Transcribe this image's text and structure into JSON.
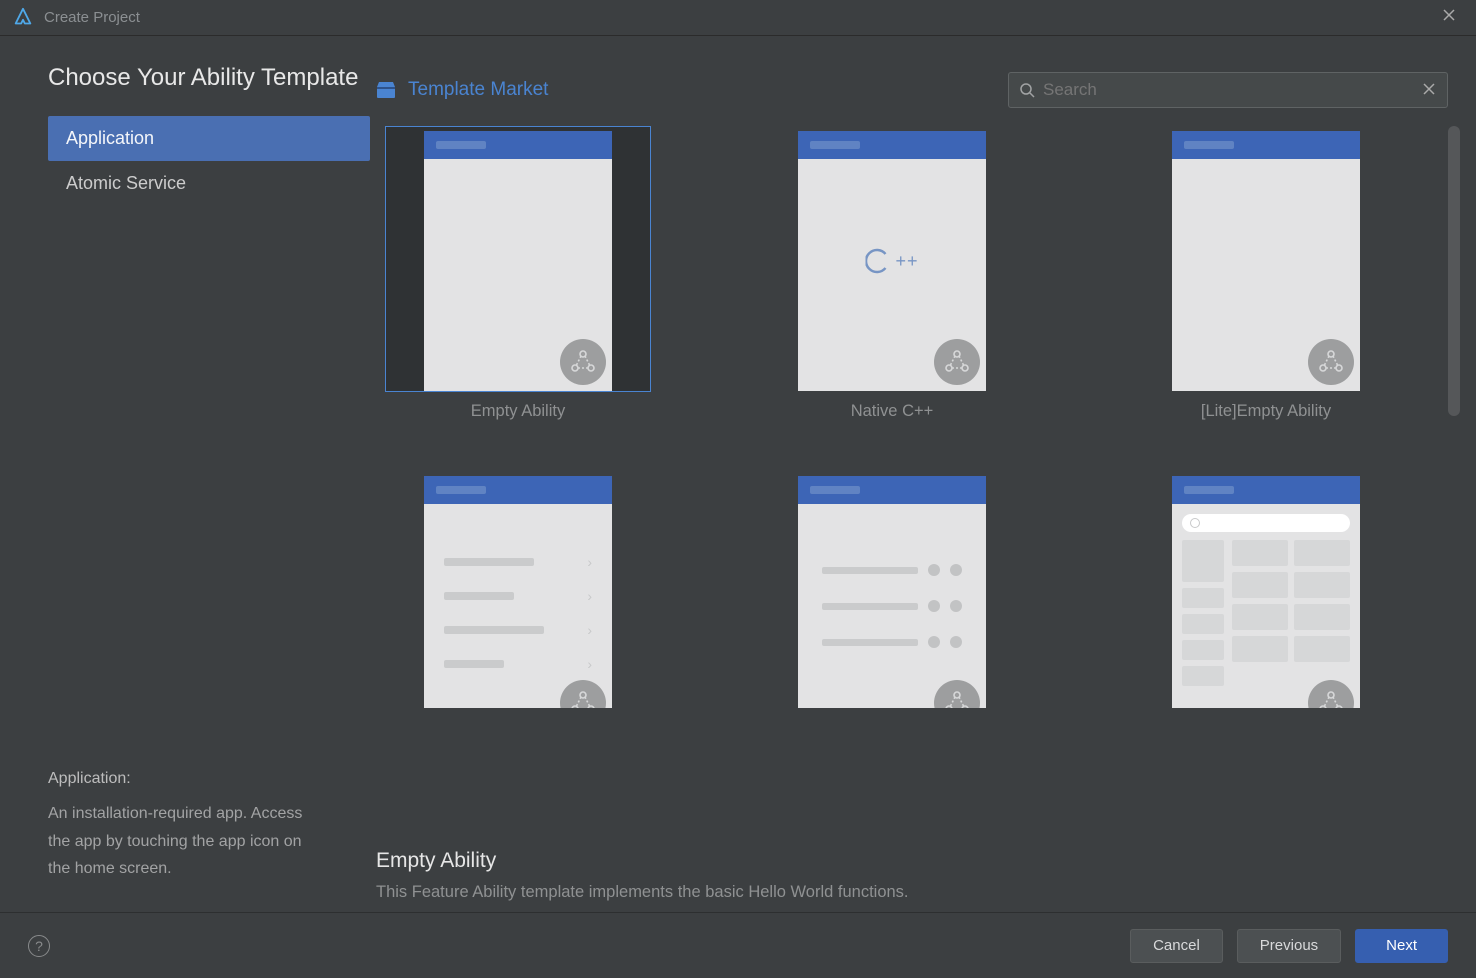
{
  "window": {
    "title": "Create Project"
  },
  "heading": "Choose Your Ability Template",
  "categories": [
    {
      "label": "Application",
      "selected": true
    },
    {
      "label": "Atomic Service",
      "selected": false
    }
  ],
  "category_description": {
    "title": "Application:",
    "body": "An installation-required app. Access the app by touching the app icon on the home screen."
  },
  "market_link": "Template Market",
  "search": {
    "placeholder": "Search",
    "value": ""
  },
  "templates": [
    {
      "name": "Empty Ability",
      "kind": "empty",
      "selected": true
    },
    {
      "name": "Native C++",
      "kind": "cpp",
      "selected": false
    },
    {
      "name": "[Lite]Empty Ability",
      "kind": "empty",
      "selected": false
    },
    {
      "name": "",
      "kind": "list",
      "selected": false
    },
    {
      "name": "",
      "kind": "dots",
      "selected": false
    },
    {
      "name": "",
      "kind": "search",
      "selected": false
    }
  ],
  "selected_template": {
    "title": "Empty Ability",
    "description": "This Feature Ability template implements the basic Hello World functions."
  },
  "buttons": {
    "cancel": "Cancel",
    "previous": "Previous",
    "next": "Next"
  }
}
